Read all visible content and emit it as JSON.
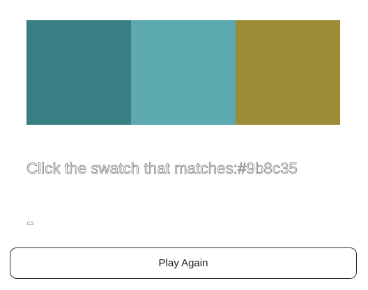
{
  "game": {
    "swatches": [
      {
        "color": "#387e82"
      },
      {
        "color": "#5ca9b0"
      },
      {
        "color": "#9b8c35"
      }
    ],
    "prompt_prefix": "Click the swatch that matches:",
    "target_hex": "#9b8c35",
    "feedback": "",
    "play_again_label": "Play Again"
  }
}
